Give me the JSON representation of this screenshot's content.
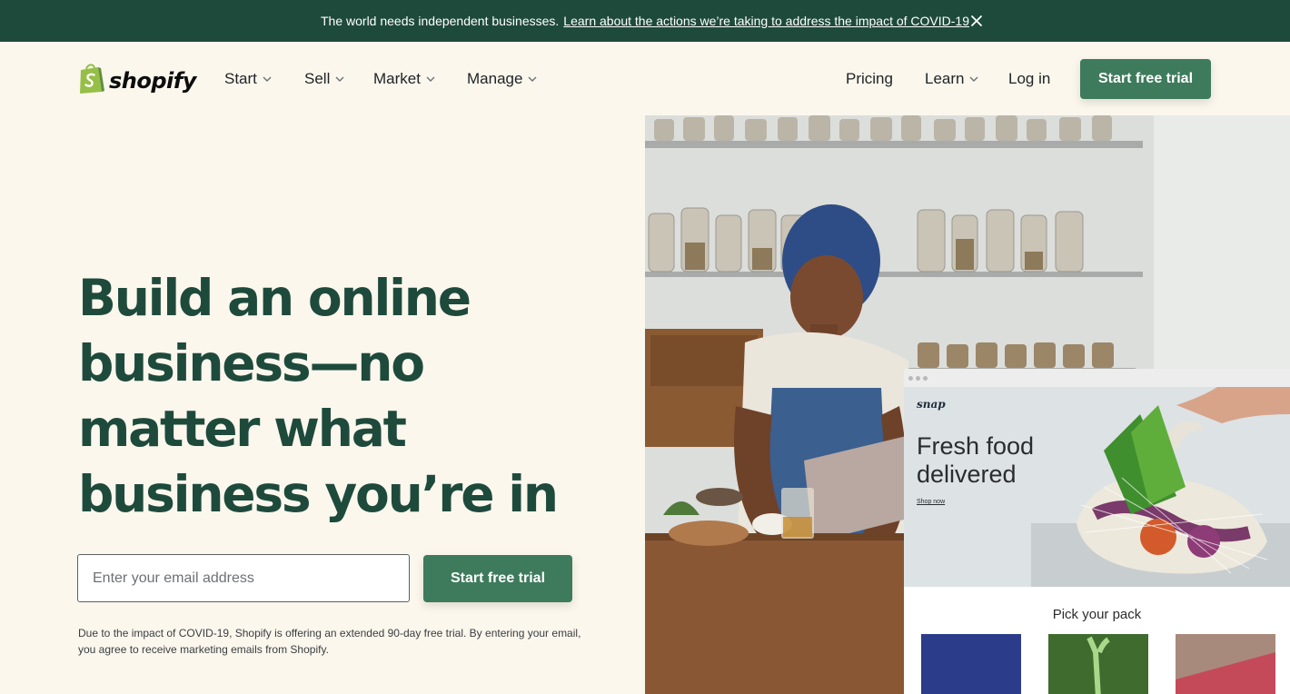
{
  "announcement": {
    "text": "The world needs independent businesses.",
    "link": "Learn about the actions we’re taking to address the impact of COVID-19"
  },
  "brand": {
    "name": "shopify",
    "accent": "#3e7b5c",
    "dark_green": "#1e4a3c",
    "bar_green": "#1e4a3c",
    "background": "#fbf7ed"
  },
  "nav": {
    "start": "Start",
    "sell": "Sell",
    "market": "Market",
    "manage": "Manage",
    "pricing": "Pricing",
    "learn": "Learn",
    "login": "Log in",
    "cta": "Start free trial"
  },
  "hero": {
    "headline_lines": [
      "Build an online",
      "business—no",
      "matter what",
      "business you’re in"
    ],
    "email_placeholder": "Enter your email address",
    "cta": "Start free trial",
    "note": "Due to the impact of COVID-19, Shopify is offering an extended 90-day free trial. By entering your email, you agree to receive marketing emails from Shopify."
  },
  "mockup": {
    "store_name": "snap",
    "heading": "Fresh food delivered",
    "link": "Shop now",
    "section_title": "Pick your pack"
  },
  "icons": {
    "close": "close-icon",
    "chevron": "chevron-down-icon",
    "logo": "shopify-bag-icon"
  }
}
